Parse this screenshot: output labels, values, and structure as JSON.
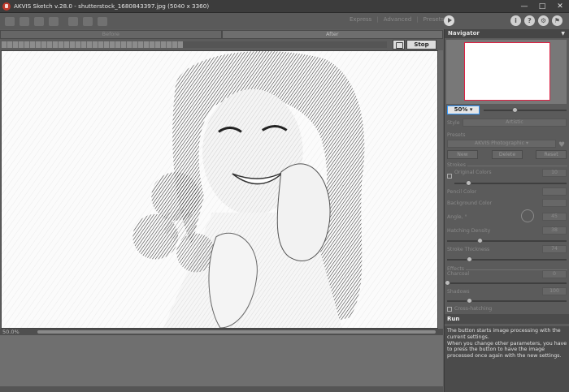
{
  "window": {
    "title": "AKVIS Sketch v.28.0 - shutterstock_1680843397.jpg (5040 x 3360)",
    "minimize": "—",
    "maximize": "□",
    "close": "✕"
  },
  "toolbar": {
    "modes": [
      "Express",
      "Advanced",
      "Presets"
    ],
    "help_icons": [
      "i",
      "?",
      "⚙",
      "⚑"
    ]
  },
  "view_tabs": {
    "before": "Before",
    "after": "After"
  },
  "processing": {
    "progress": 0.47,
    "stop_label": "Stop"
  },
  "status": {
    "zoom": "50.0%"
  },
  "navigator": {
    "title": "Navigator",
    "zoom": "50%"
  },
  "settings": {
    "style_label": "Style",
    "style_value": "Artistic",
    "presets_label": "Presets",
    "preset_value": "AKVIS Photographic",
    "new_label": "New",
    "delete_label": "Delete",
    "reset_label": "Reset",
    "strokes_group": "Strokes",
    "original_colors": "Original Colors",
    "original_colors_val": "10",
    "pencil_color": "Pencil Color",
    "background_color": "Background Color",
    "angle": "Angle, °",
    "angle_val": "45",
    "hatching_density": "Hatching Density",
    "hatching_density_val": "38",
    "stroke_thickness": "Stroke Thickness",
    "stroke_thickness_val": "74",
    "effects_group": "Effects",
    "charcoal": "Charcoal",
    "charcoal_val": "0",
    "shadows": "Shadows",
    "shadows_val": "100",
    "cross_hatching": "Cross-hatching"
  },
  "help": {
    "title": "Run",
    "text": "The button starts image processing with the current settings.\nWhen you change other parameters, you have to press the button to have the image processed once again with the new settings."
  }
}
